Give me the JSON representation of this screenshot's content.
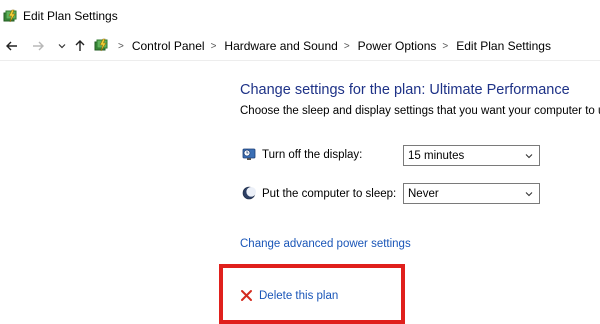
{
  "window": {
    "title": "Edit Plan Settings",
    "icon": "power-options-icon"
  },
  "addressbar": {
    "back_icon": "arrow-left-icon",
    "forward_icon": "arrow-right-icon",
    "recent_icon": "chevron-down-icon",
    "up_icon": "arrow-up-icon",
    "location_icon": "control-panel-icon",
    "separator": ">",
    "breadcrumbs": [
      "Control Panel",
      "Hardware and Sound",
      "Power Options",
      "Edit Plan Settings"
    ]
  },
  "main": {
    "heading": "Change settings for the plan: Ultimate Performance",
    "subtext": "Choose the sleep and display settings that you want your computer to use.",
    "settings": [
      {
        "label": "Turn off the display:",
        "icon": "monitor-clock-icon",
        "value": "15 minutes"
      },
      {
        "label": "Put the computer to sleep:",
        "icon": "moon-icon",
        "value": "Never"
      }
    ],
    "advanced_link": "Change advanced power settings",
    "delete_link": "Delete this plan",
    "delete_icon": "red-x-icon"
  },
  "colors": {
    "heading": "#1e3287",
    "link": "#1a56b8",
    "highlight_box": "#e0201c"
  }
}
